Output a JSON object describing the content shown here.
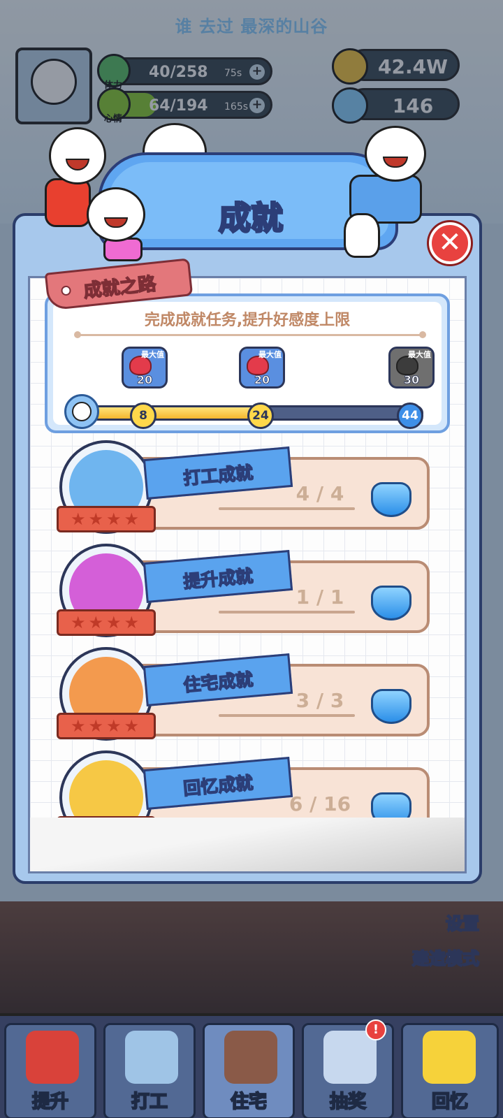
{
  "header": {
    "top_title": "谁 去过 最深的山谷"
  },
  "stats": [
    {
      "icon": "stamina-icon",
      "label": "体力",
      "value": "40/258",
      "timer": "75s",
      "fill_fraction": 0.16,
      "color": "#5fc36a"
    },
    {
      "icon": "heart-icon",
      "label": "心情",
      "value": "64/194",
      "timer": "165s",
      "fill_fraction": 0.33,
      "color": "#8fcf3a"
    }
  ],
  "currencies": [
    {
      "icon": "coin-icon",
      "value": "42.4W",
      "color": "#f6c845"
    },
    {
      "icon": "diamond-icon",
      "value": "146",
      "color": "#8fd3ff"
    }
  ],
  "panel": {
    "title": "成就",
    "close_icon": "close-icon"
  },
  "road": {
    "tag": "成就之路",
    "subtitle": "完成成就任务,提升好感度上限",
    "progress_fraction": 0.52,
    "milestones": [
      {
        "node": "8",
        "reward": "20",
        "max_label": "最大值",
        "state": "claimed"
      },
      {
        "node": "24",
        "reward": "20",
        "max_label": "最大值",
        "state": "claimed"
      },
      {
        "node": "44",
        "reward": "30",
        "max_label": "最大值",
        "state": "locked"
      }
    ]
  },
  "achievements": [
    {
      "name": "打工成就",
      "progress": "4 / 4",
      "medal_color": "#6fb5ef",
      "stars": "★★★★"
    },
    {
      "name": "提升成就",
      "progress": "1 / 1",
      "medal_color": "#d45fd8",
      "stars": "★★★★"
    },
    {
      "name": "住宅成就",
      "progress": "3 / 3",
      "medal_color": "#f39a4e",
      "stars": "★★★★"
    },
    {
      "name": "回忆成就",
      "progress": "6 / 16",
      "medal_color": "#f6c845",
      "stars": "★★★★"
    }
  ],
  "side": {
    "settings": "设置",
    "build_mode": "建造模式"
  },
  "nav": [
    {
      "label": "提升",
      "icon": "book-icon",
      "color": "#d9423a"
    },
    {
      "label": "打工",
      "icon": "work-icon",
      "color": "#9fc4e6"
    },
    {
      "label": "住宅",
      "icon": "house-icon",
      "color": "#8a5a48"
    },
    {
      "label": "抽奖",
      "icon": "gacha-icon",
      "color": "#c7d8ee",
      "badge": "!"
    },
    {
      "label": "回忆",
      "icon": "camera-icon",
      "color": "#f6d23a"
    }
  ]
}
